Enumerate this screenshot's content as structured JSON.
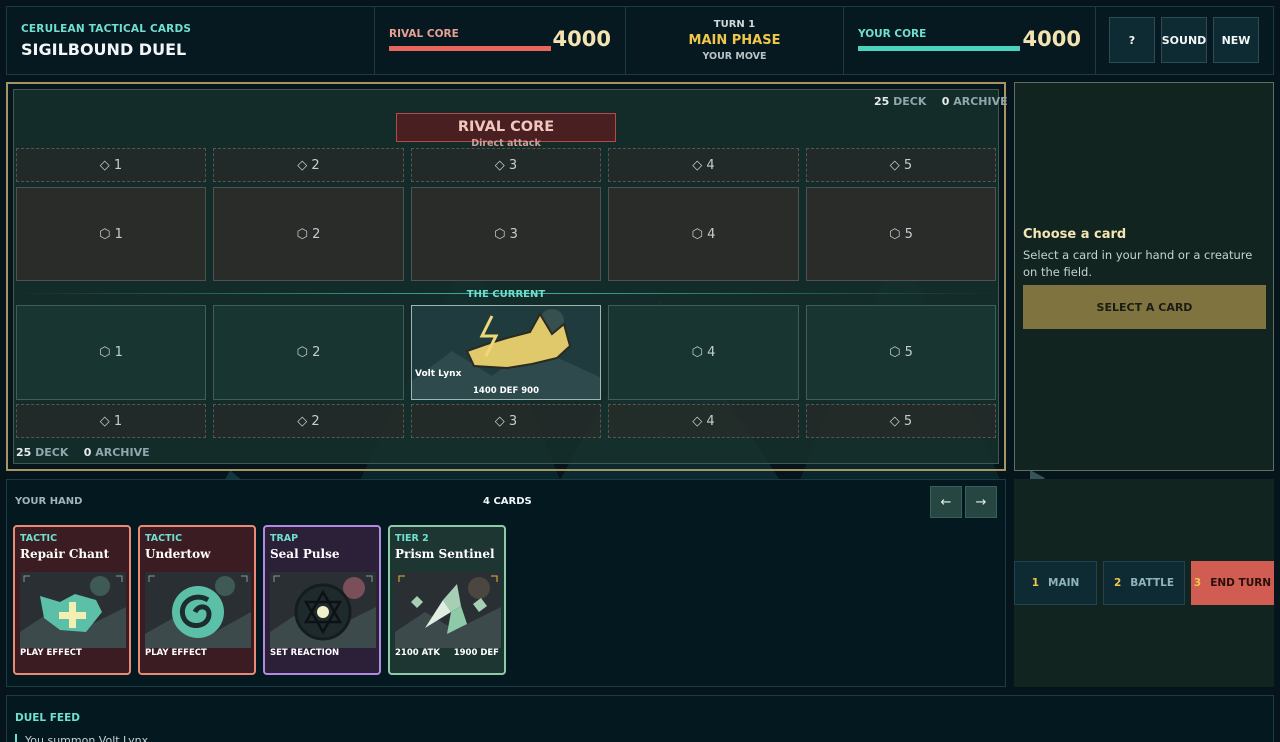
{
  "header": {
    "brand_sub": "CERULEAN TACTICAL CARDS",
    "brand_title": "SIGILBOUND DUEL",
    "rival": {
      "label": "RIVAL CORE",
      "value": "4000",
      "color": "#e8675c"
    },
    "turn": {
      "turn_label": "TURN 1",
      "phase": "MAIN PHASE",
      "whose": "YOUR MOVE"
    },
    "you": {
      "label": "YOUR CORE",
      "value": "4000",
      "color": "#4cd3bf"
    },
    "buttons": {
      "help": "?",
      "sound": "SOUND",
      "new": "NEW"
    }
  },
  "board": {
    "rival_deck": {
      "deck_count": "25",
      "deck_label": "DECK",
      "archive_count": "0",
      "archive_label": "ARCHIVE"
    },
    "rival_core": {
      "label": "RIVAL CORE",
      "sub": "Direct attack"
    },
    "rival_support": [
      "◇ 1",
      "◇ 2",
      "◇ 3",
      "◇ 4",
      "◇ 5"
    ],
    "rival_creatures": [
      "⬡ 1",
      "⬡ 2",
      "⬡ 3",
      "⬡ 4",
      "⬡ 5"
    ],
    "current_label": "THE CURRENT",
    "player_creatures": [
      "⬡ 1",
      "⬡ 2",
      "",
      "⬡ 4",
      "⬡ 5"
    ],
    "creature": {
      "name": "Volt Lynx",
      "stats": "1400  DEF 900",
      "icon": "lynx-icon"
    },
    "player_support": [
      "◇ 1",
      "◇ 2",
      "◇ 3",
      "◇ 4",
      "◇ 5"
    ],
    "player_deck": {
      "deck_count": "25",
      "deck_label": "DECK",
      "archive_count": "0",
      "archive_label": "ARCHIVE"
    }
  },
  "side": {
    "title": "Choose a card",
    "text": "Select a card in your hand or a creature on the field.",
    "button": "SELECT A CARD"
  },
  "hand": {
    "label": "YOUR HAND",
    "count": "4 CARDS",
    "prev_icon": "←",
    "next_icon": "→",
    "cards": [
      {
        "type": "TACTIC",
        "name": "Repair Chant",
        "foot_left": "PLAY EFFECT",
        "foot_right": "",
        "icon": "repair-icon",
        "border": "#e98a76",
        "type_color": "#6fe0d0"
      },
      {
        "type": "TACTIC",
        "name": "Undertow",
        "foot_left": "PLAY EFFECT",
        "foot_right": "",
        "icon": "swirl-icon",
        "border": "#e98a76",
        "type_color": "#6fe0d0"
      },
      {
        "type": "TRAP",
        "name": "Seal Pulse",
        "foot_left": "SET REACTION",
        "foot_right": "",
        "icon": "hexagram-icon",
        "border": "#b18ae0",
        "type_color": "#6fe0d0"
      },
      {
        "type": "TIER 2",
        "name": "Prism Sentinel",
        "foot_left": "2100 ATK",
        "foot_right": "1900 DEF",
        "icon": "prism-icon",
        "border": "#8ec9a8",
        "type_color": "#6fe0d0"
      }
    ]
  },
  "phases": [
    {
      "num": "1",
      "label": "MAIN"
    },
    {
      "num": "2",
      "label": "BATTLE"
    },
    {
      "num": "3",
      "label": "END TURN"
    }
  ],
  "feed": {
    "label": "DUEL FEED",
    "entries": [
      "You summon Volt Lynx."
    ]
  }
}
